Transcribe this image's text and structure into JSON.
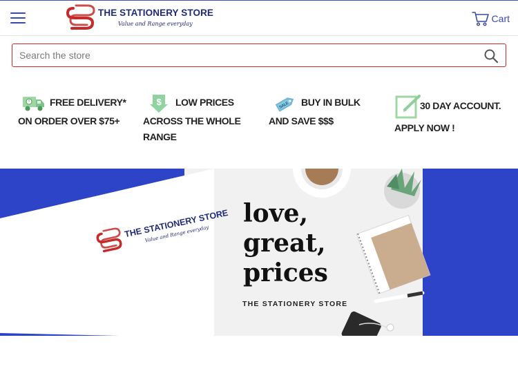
{
  "header": {
    "menu_icon": "hamburger-menu-icon",
    "logo": {
      "name": "THE STATIONERY STORE",
      "tagline": "Value and Range everyday"
    },
    "cart_label": "Cart"
  },
  "search": {
    "placeholder": "Search the store"
  },
  "features": [
    {
      "icon": "delivery-truck-icon",
      "line1": "FREE DELIVERY*",
      "line2": "ON ORDER OVER $75+",
      "line3": ""
    },
    {
      "icon": "dollar-tag-icon",
      "line1": "LOW PRICES",
      "line2": "ACROSS THE WHOLE",
      "line3": "RANGE"
    },
    {
      "icon": "price-tag-icon",
      "line1": "BUY IN BULK",
      "line2": "AND SAVE $$$",
      "line3": ""
    },
    {
      "icon": "edit-account-icon",
      "line1": "30 DAY ACCOUNT.",
      "line2": "APPLY NOW !",
      "line3": ""
    }
  ],
  "banner": {
    "headline": [
      "love,",
      "great,",
      "prices"
    ],
    "subtitle": "THE STATIONERY STORE",
    "logo": {
      "name": "THE STATIONERY STORE",
      "tagline": "Value and Range everyday"
    }
  },
  "colors": {
    "brand_blue": "#2d44c8",
    "brand_red": "#c62b2b",
    "navy": "#1f2a7a"
  }
}
